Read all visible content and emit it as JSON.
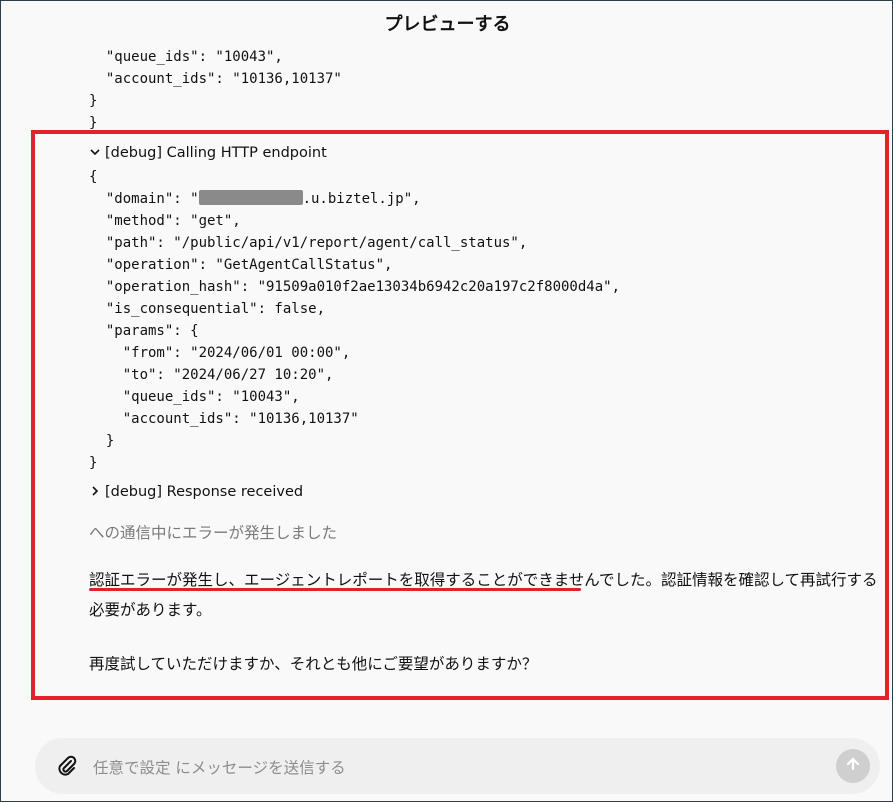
{
  "header": {
    "title": "プレビューする"
  },
  "prev_code_lines": [
    "  \"queue_ids\": \"10043\",",
    "  \"account_ids\": \"10136,10137\"",
    "}",
    "}"
  ],
  "debug_call": {
    "label": "[debug] Calling HTTP endpoint",
    "expanded": true
  },
  "code": {
    "open": "{",
    "domain_key": "  \"domain\": \"",
    "domain_suffix": ".u.biztel.jp\",",
    "lines": [
      "  \"method\": \"get\",",
      "  \"path\": \"/public/api/v1/report/agent/call_status\",",
      "  \"operation\": \"GetAgentCallStatus\",",
      "  \"operation_hash\": \"91509a010f2ae13034b6942c20a197c2f8000d4a\",",
      "  \"is_consequential\": false,",
      "  \"params\": {",
      "    \"from\": \"2024/06/01 00:00\",",
      "    \"to\": \"2024/06/27 10:20\",",
      "    \"queue_ids\": \"10043\",",
      "    \"account_ids\": \"10136,10137\"",
      "  }",
      "}"
    ]
  },
  "debug_response": {
    "label": "[debug] Response received",
    "expanded": false
  },
  "messages": {
    "error_line": "への通信中にエラーが発生しました",
    "paragraph1": "認証エラーが発生し、エージェントレポートを取得することができませんでした。認証情報を確認して再試行する必要があります。",
    "paragraph2": "再度試していただけますか、それとも他にご要望がありますか？"
  },
  "composer": {
    "placeholder": "任意で設定 にメッセージを送信する"
  },
  "icons": {
    "attach": "paperclip-icon",
    "send": "arrow-up-icon",
    "expand": "chevron-down-icon",
    "collapse": "chevron-right-icon"
  },
  "colors": {
    "highlight": "#e0222a"
  }
}
